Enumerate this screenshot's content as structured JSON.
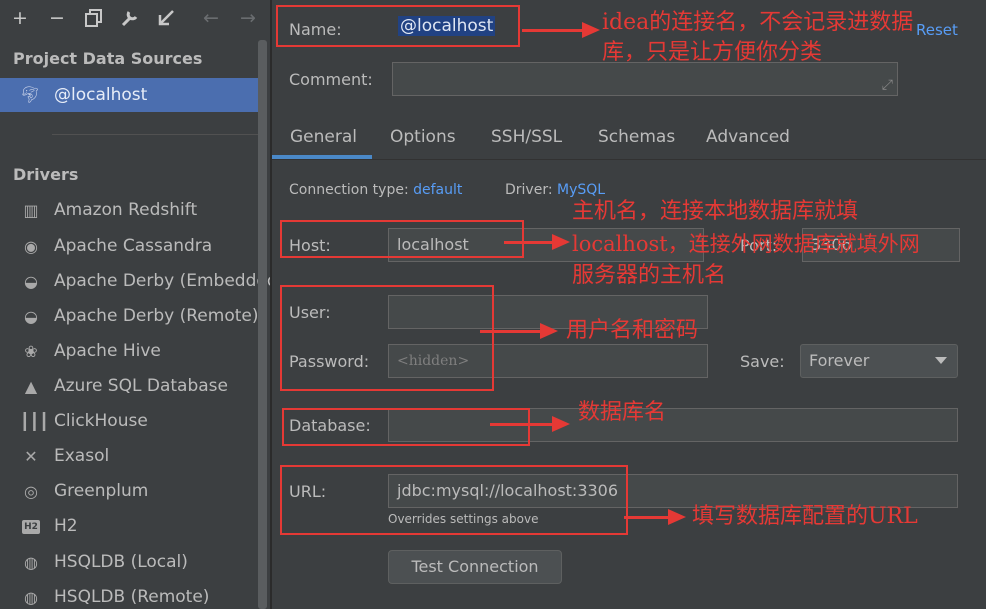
{
  "toolbar": {
    "add_icon": "plus-icon",
    "remove_icon": "minus-icon",
    "duplicate_icon": "copy-icon",
    "properties_icon": "wrench-icon",
    "goto_icon": "arrow-down-left-icon",
    "back_icon": "arrow-left-icon",
    "forward_icon": "arrow-right-icon"
  },
  "sidebar": {
    "project_title": "Project Data Sources",
    "project_items": [
      {
        "label": "@localhost",
        "selected": true
      }
    ],
    "drivers_title": "Drivers",
    "drivers": [
      {
        "label": "Amazon Redshift",
        "icon": "redshift-icon"
      },
      {
        "label": "Apache Cassandra",
        "icon": "eye-icon"
      },
      {
        "label": "Apache Derby (Embedded)",
        "icon": "derby-hat-icon"
      },
      {
        "label": "Apache Derby (Remote)",
        "icon": "derby-hat-icon"
      },
      {
        "label": "Apache Hive",
        "icon": "hive-icon"
      },
      {
        "label": "Azure SQL Database",
        "icon": "azure-icon"
      },
      {
        "label": "ClickHouse",
        "icon": "clickhouse-icon"
      },
      {
        "label": "Exasol",
        "icon": "exasol-icon"
      },
      {
        "label": "Greenplum",
        "icon": "greenplum-icon"
      },
      {
        "label": "H2",
        "icon": "h2-icon",
        "badge": "H2"
      },
      {
        "label": "HSQLDB (Local)",
        "icon": "hsqldb-icon"
      },
      {
        "label": "HSQLDB (Remote)",
        "icon": "hsqldb-icon"
      }
    ]
  },
  "form": {
    "name_label": "Name:",
    "name_value": "@localhost",
    "reset_label": "Reset",
    "comment_label": "Comment:",
    "comment_value": "",
    "tabs": [
      "General",
      "Options",
      "SSH/SSL",
      "Schemas",
      "Advanced"
    ],
    "active_tab": "General",
    "connection_type_label": "Connection type:",
    "connection_type_value": "default",
    "driver_label": "Driver:",
    "driver_value": "MySQL",
    "host_label": "Host:",
    "host_value": "localhost",
    "port_label": "Port:",
    "port_value": "3306",
    "user_label": "User:",
    "user_value": "",
    "password_label": "Password:",
    "password_placeholder": "<hidden>",
    "save_label": "Save:",
    "save_value": "Forever",
    "database_label": "Database:",
    "database_value": "",
    "url_label": "URL:",
    "url_value": "jdbc:mysql://localhost:3306",
    "url_hint": "Overrides settings above",
    "test_button": "Test Connection"
  },
  "annotations": {
    "name_note_line1": "idea的连接名，不会记录进数据",
    "name_note_line2": "库，只是让方便你分类",
    "host_note_line1": "主机名，连接本地数据库就填",
    "host_note_line2": "localhost，连接外网数据库就填外网",
    "host_note_line3": "服务器的主机名",
    "user_note": "用户名和密码",
    "database_note": "数据库名",
    "url_note": "填写数据库配置的URL",
    "color": "#e53935"
  },
  "colors": {
    "background": "#3c3f41",
    "selection": "#4b6eaf",
    "link": "#589df6",
    "tab_underline": "#4a88c7"
  }
}
